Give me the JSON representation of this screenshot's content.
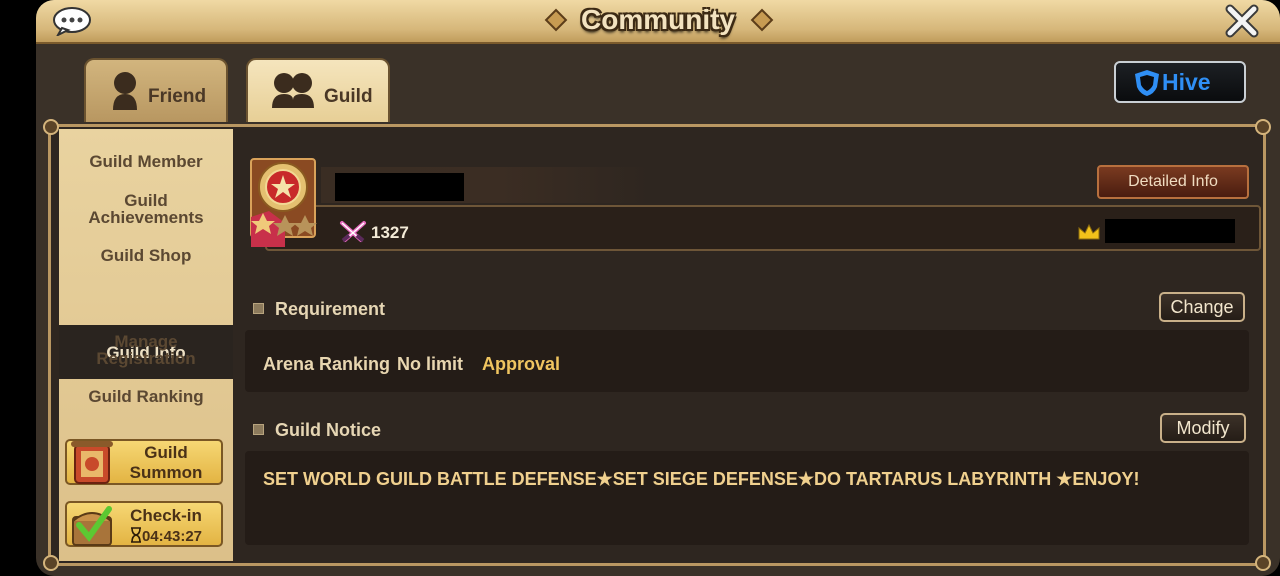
{
  "window": {
    "title": "Community"
  },
  "tabs": [
    {
      "label": "Friend",
      "icon": "person-icon"
    },
    {
      "label": "Guild",
      "icon": "group-icon"
    }
  ],
  "hive": {
    "label": "Hive"
  },
  "sidebar": {
    "items": [
      {
        "label": "Guild Member"
      },
      {
        "label": "Guild Achievements"
      },
      {
        "label": "Guild Shop"
      },
      {
        "label": "Guild Info"
      },
      {
        "label": "Manage Registration"
      },
      {
        "label": "Guild Ranking"
      }
    ],
    "summon_label": "Guild Summon",
    "checkin_label": "Check-in",
    "checkin_timer": "04:43:27"
  },
  "guild": {
    "score": "1327",
    "detailed_info_label": "Detailed Info"
  },
  "requirement": {
    "title": "Requirement",
    "change_label": "Change",
    "arena_label": "Arena Ranking",
    "arena_value": "No limit",
    "approval": "Approval"
  },
  "notice": {
    "title": "Guild Notice",
    "modify_label": "Modify",
    "text": "SET WORLD GUILD BATTLE DEFENSE★SET SIEGE DEFENSE★DO TARTARUS LABYRINTH ★ENJOY!"
  },
  "colors": {
    "gold_text": "#f0d08e",
    "hive_blue": "#2f8ff5",
    "panel_bg": "#2e2620"
  }
}
